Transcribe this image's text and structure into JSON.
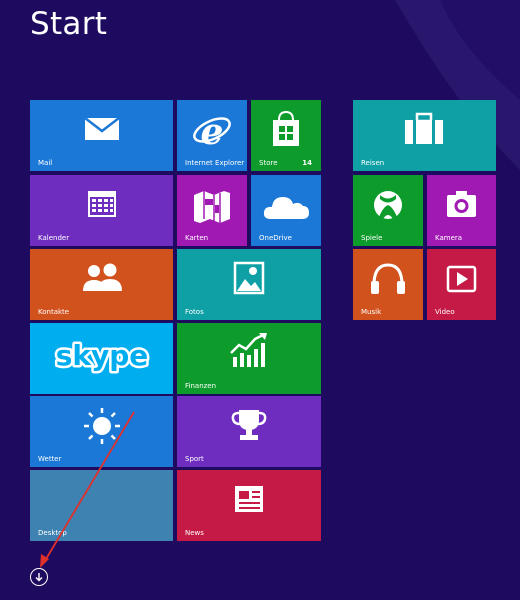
{
  "screen": {
    "title": "Start",
    "background": "#1e0a5e"
  },
  "tiles": [
    {
      "key": "mail",
      "label": "Mail",
      "color": "#1b78d6",
      "icon": "envelope-icon"
    },
    {
      "key": "ie",
      "label": "Internet Explorer",
      "color": "#1b78d6",
      "icon": "internet-explorer-icon"
    },
    {
      "key": "store",
      "label": "Store",
      "color": "#0d9c2b",
      "icon": "store-bag-icon",
      "badge": "14"
    },
    {
      "key": "kalender",
      "label": "Kalender",
      "color": "#6e2dbf",
      "icon": "calendar-icon"
    },
    {
      "key": "karten",
      "label": "Karten",
      "color": "#a019b3",
      "icon": "map-icon"
    },
    {
      "key": "onedrive",
      "label": "OneDrive",
      "color": "#1b78d6",
      "icon": "cloud-icon"
    },
    {
      "key": "kontakte",
      "label": "Kontakte",
      "color": "#d2521e",
      "icon": "people-icon"
    },
    {
      "key": "fotos",
      "label": "Fotos",
      "color": "#0fa0a6",
      "icon": "photo-icon"
    },
    {
      "key": "skype",
      "label": "",
      "color": "#00adef",
      "icon": "skype-logo-icon",
      "logo_text": "skype"
    },
    {
      "key": "finanzen",
      "label": "Finanzen",
      "color": "#0d9c2b",
      "icon": "finance-chart-icon"
    },
    {
      "key": "wetter",
      "label": "Wetter",
      "color": "#1b78d6",
      "icon": "sun-icon"
    },
    {
      "key": "sport",
      "label": "Sport",
      "color": "#6e2dbf",
      "icon": "trophy-icon"
    },
    {
      "key": "desktop",
      "label": "Desktop",
      "color": "#3e82b2",
      "icon": ""
    },
    {
      "key": "news",
      "label": "News",
      "color": "#c41a45",
      "icon": "newspaper-icon"
    },
    {
      "key": "reisen",
      "label": "Reisen",
      "color": "#0fa0a6",
      "icon": "suitcase-icon"
    },
    {
      "key": "spiele",
      "label": "Spiele",
      "color": "#0d9c2b",
      "icon": "gamepad-icon"
    },
    {
      "key": "kamera",
      "label": "Kamera",
      "color": "#a019b3",
      "icon": "camera-icon"
    },
    {
      "key": "musik",
      "label": "Musik",
      "color": "#d2521e",
      "icon": "headphones-icon"
    },
    {
      "key": "video",
      "label": "Video",
      "color": "#c41a45",
      "icon": "video-icon"
    }
  ],
  "apps_button": {
    "icon": "down-arrow-circle-icon"
  },
  "annotation": {
    "color": "#e0302b",
    "icon": "red-arrow-annotation"
  }
}
